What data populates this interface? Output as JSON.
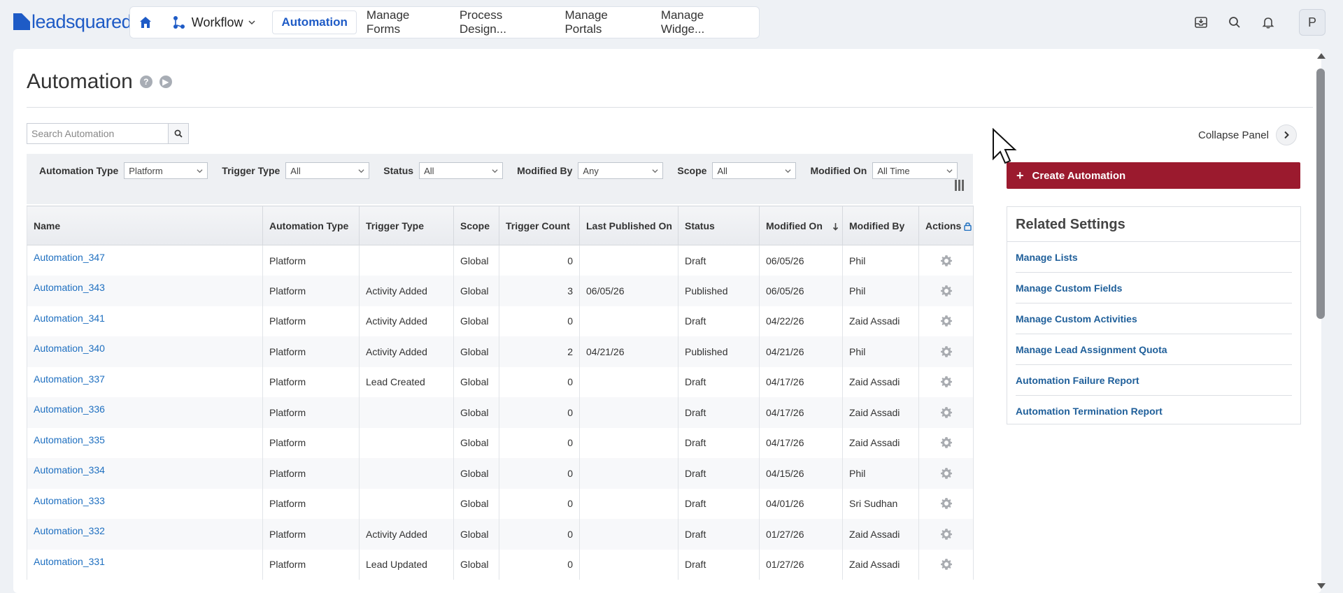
{
  "brand": {
    "name": "leadsquared"
  },
  "nav": {
    "workflow_label": "Workflow",
    "tabs": [
      {
        "label": "Automation",
        "active": true
      },
      {
        "label": "Manage Forms",
        "active": false
      },
      {
        "label": "Process Design...",
        "active": false
      },
      {
        "label": "Manage Portals",
        "active": false
      },
      {
        "label": "Manage Widge...",
        "active": false
      }
    ]
  },
  "user": {
    "initial": "P"
  },
  "page": {
    "title": "Automation"
  },
  "search": {
    "placeholder": "Search Automation",
    "value": ""
  },
  "filters": [
    {
      "label": "Automation Type",
      "value": "Platform"
    },
    {
      "label": "Trigger Type",
      "value": "All"
    },
    {
      "label": "Status",
      "value": "All"
    },
    {
      "label": "Modified By",
      "value": "Any"
    },
    {
      "label": "Scope",
      "value": "All"
    },
    {
      "label": "Modified On",
      "value": "All Time"
    }
  ],
  "table": {
    "columns": [
      "Name",
      "Automation Type",
      "Trigger Type",
      "Scope",
      "Trigger Count",
      "Last Published On",
      "Status",
      "Modified On",
      "Modified By",
      "Actions"
    ],
    "sorted_column": "Modified On",
    "rows": [
      {
        "name": "Automation_347",
        "type": "Platform",
        "trigger": "",
        "scope": "Global",
        "count": "0",
        "published": "",
        "status": "Draft",
        "modified_on": "06/05/26",
        "modified_by": "Phil"
      },
      {
        "name": "Automation_343",
        "type": "Platform",
        "trigger": "Activity Added",
        "scope": "Global",
        "count": "3",
        "published": "06/05/26",
        "status": "Published",
        "modified_on": "06/05/26",
        "modified_by": "Phil"
      },
      {
        "name": "Automation_341",
        "type": "Platform",
        "trigger": "Activity Added",
        "scope": "Global",
        "count": "0",
        "published": "",
        "status": "Draft",
        "modified_on": "04/22/26",
        "modified_by": "Zaid Assadi"
      },
      {
        "name": "Automation_340",
        "type": "Platform",
        "trigger": "Activity Added",
        "scope": "Global",
        "count": "2",
        "published": "04/21/26",
        "status": "Published",
        "modified_on": "04/21/26",
        "modified_by": "Phil"
      },
      {
        "name": "Automation_337",
        "type": "Platform",
        "trigger": "Lead Created",
        "scope": "Global",
        "count": "0",
        "published": "",
        "status": "Draft",
        "modified_on": "04/17/26",
        "modified_by": "Zaid Assadi"
      },
      {
        "name": "Automation_336",
        "type": "Platform",
        "trigger": "",
        "scope": "Global",
        "count": "0",
        "published": "",
        "status": "Draft",
        "modified_on": "04/17/26",
        "modified_by": "Zaid Assadi"
      },
      {
        "name": "Automation_335",
        "type": "Platform",
        "trigger": "",
        "scope": "Global",
        "count": "0",
        "published": "",
        "status": "Draft",
        "modified_on": "04/17/26",
        "modified_by": "Zaid Assadi"
      },
      {
        "name": "Automation_334",
        "type": "Platform",
        "trigger": "",
        "scope": "Global",
        "count": "0",
        "published": "",
        "status": "Draft",
        "modified_on": "04/15/26",
        "modified_by": "Phil"
      },
      {
        "name": "Automation_333",
        "type": "Platform",
        "trigger": "",
        "scope": "Global",
        "count": "0",
        "published": "",
        "status": "Draft",
        "modified_on": "04/01/26",
        "modified_by": "Sri Sudhan"
      },
      {
        "name": "Automation_332",
        "type": "Platform",
        "trigger": "Activity Added",
        "scope": "Global",
        "count": "0",
        "published": "",
        "status": "Draft",
        "modified_on": "01/27/26",
        "modified_by": "Zaid Assadi"
      },
      {
        "name": "Automation_331",
        "type": "Platform",
        "trigger": "Lead Updated",
        "scope": "Global",
        "count": "0",
        "published": "",
        "status": "Draft",
        "modified_on": "01/27/26",
        "modified_by": "Zaid Assadi"
      }
    ]
  },
  "side": {
    "collapse_label": "Collapse Panel",
    "create_label": "Create Automation",
    "related_title": "Related Settings",
    "related_items": [
      "Manage Lists",
      "Manage Custom Fields",
      "Manage Custom Activities",
      "Manage Lead Assignment Quota",
      "Automation Failure Report",
      "Automation Termination Report"
    ]
  },
  "colors": {
    "brand": "#1e5bc6",
    "primary_button": "#9b1a2e",
    "link": "#1e6fc0"
  }
}
